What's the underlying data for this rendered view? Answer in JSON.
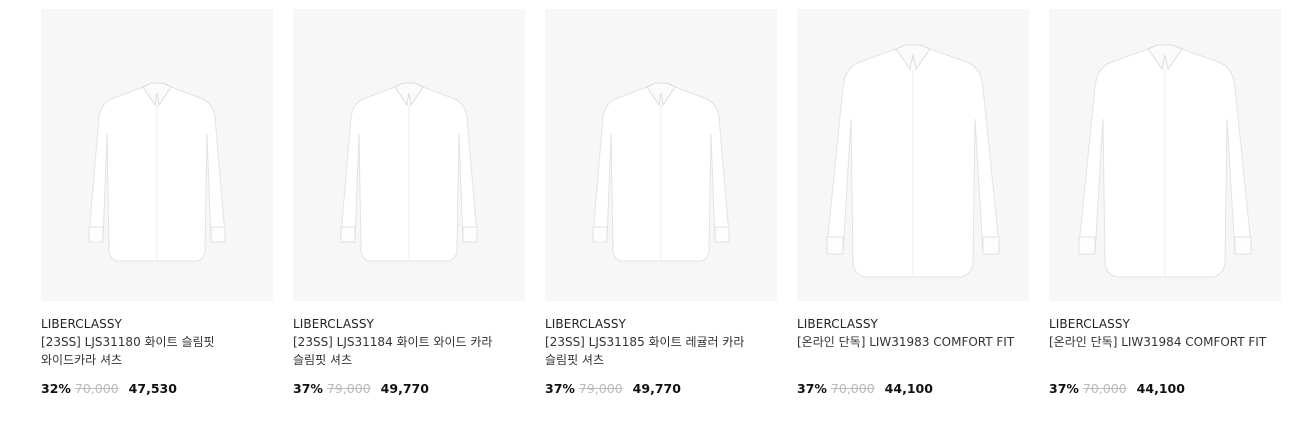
{
  "products": [
    {
      "brand": "LIBERCLASSY",
      "name": "[23SS] LJS31180 화이트 슬림핏 와이드카라 셔츠",
      "discount": "32%",
      "original_price": "70,000",
      "price": "47,530",
      "image": "folded-white-shirt-image"
    },
    {
      "brand": "LIBERCLASSY",
      "name": "[23SS] LJS31184 화이트 와이드 카라 슬림핏 셔츠",
      "discount": "37%",
      "original_price": "79,000",
      "price": "49,770",
      "image": "folded-white-shirt-image"
    },
    {
      "brand": "LIBERCLASSY",
      "name": "[23SS] LJS31185 화이트 레귤러 카라 슬림핏 셔츠",
      "discount": "37%",
      "original_price": "79,000",
      "price": "49,770",
      "image": "folded-white-shirt-image"
    },
    {
      "brand": "LIBERCLASSY",
      "name": "[온라인 단독] LIW31983 COMFORT FIT",
      "discount": "37%",
      "original_price": "70,000",
      "price": "44,100",
      "image": "white-shirt-image"
    },
    {
      "brand": "LIBERCLASSY",
      "name": "[온라인 단독] LIW31984 COMFORT FIT",
      "discount": "37%",
      "original_price": "70,000",
      "price": "44,100",
      "image": "white-shirt-image"
    }
  ]
}
